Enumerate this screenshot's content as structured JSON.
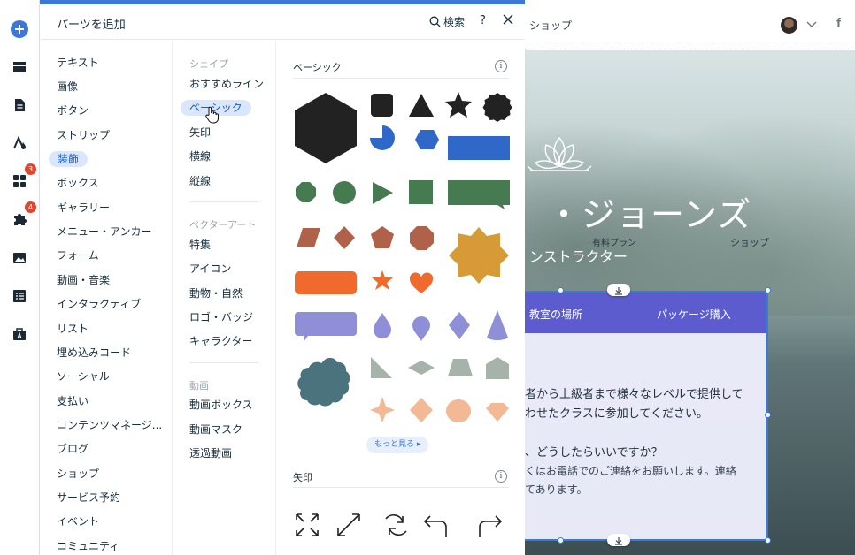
{
  "panel": {
    "title": "パーツを追加",
    "search_label": "検索",
    "help_label": "?"
  },
  "toolbar": {
    "badges": {
      "apps": "3",
      "integrations": "4"
    }
  },
  "categories": [
    "テキスト",
    "画像",
    "ボタン",
    "ストリップ",
    "装飾",
    "ボックス",
    "ギャラリー",
    "メニュー・アンカー",
    "フォーム",
    "動画・音楽",
    "インタラクティブ",
    "リスト",
    "埋め込みコード",
    "ソーシャル",
    "支払い",
    "コンテンツマネージ...",
    "ブログ",
    "ショップ",
    "サービス予約",
    "イベント",
    "コミュニティ"
  ],
  "subcategories": {
    "shape_head": "シェイプ",
    "shape_items": [
      "おすすめライン",
      "ベーシック",
      "矢印",
      "横線",
      "縦線"
    ],
    "vector_head": "ベクターアート",
    "vector_items": [
      "特集",
      "アイコン",
      "動物・自然",
      "ロゴ・バッジ",
      "キャラクター"
    ],
    "video_head": "動画",
    "video_items": [
      "動画ボックス",
      "動画マスク",
      "透過動画"
    ]
  },
  "content": {
    "basic_title": "ベーシック",
    "more_label": "もっと見る ▸",
    "arrow_title": "矢印",
    "info": "i"
  },
  "colors": {
    "accent": "#3b78d8",
    "black": "#222222",
    "blue": "#2f68c8",
    "green": "#467a50",
    "brown": "#b0614a",
    "orange": "#ef6a2c",
    "mustard": "#d69a37",
    "lavender": "#8f8fd8",
    "sage": "#a6b3aa",
    "peach": "#f3b894",
    "slate": "#4b737e"
  },
  "site": {
    "header_shop": "ショップ",
    "hero_title": "・ジョーンズ",
    "hero_sub": "ンストラクター",
    "hero_plan": "有料プラン",
    "hero_shop": "ショップ",
    "strip_tab1": "教室の場所",
    "strip_tab2": "パッケージ購入",
    "text1": "者から上級者まで様々なレベルで提供して",
    "text2": "わせたクラスに参加してください。",
    "text3": "、どうしたらいいですか？",
    "text4": "くはお電話でのご連絡をお願いします。連絡",
    "text5": "てあります。"
  }
}
